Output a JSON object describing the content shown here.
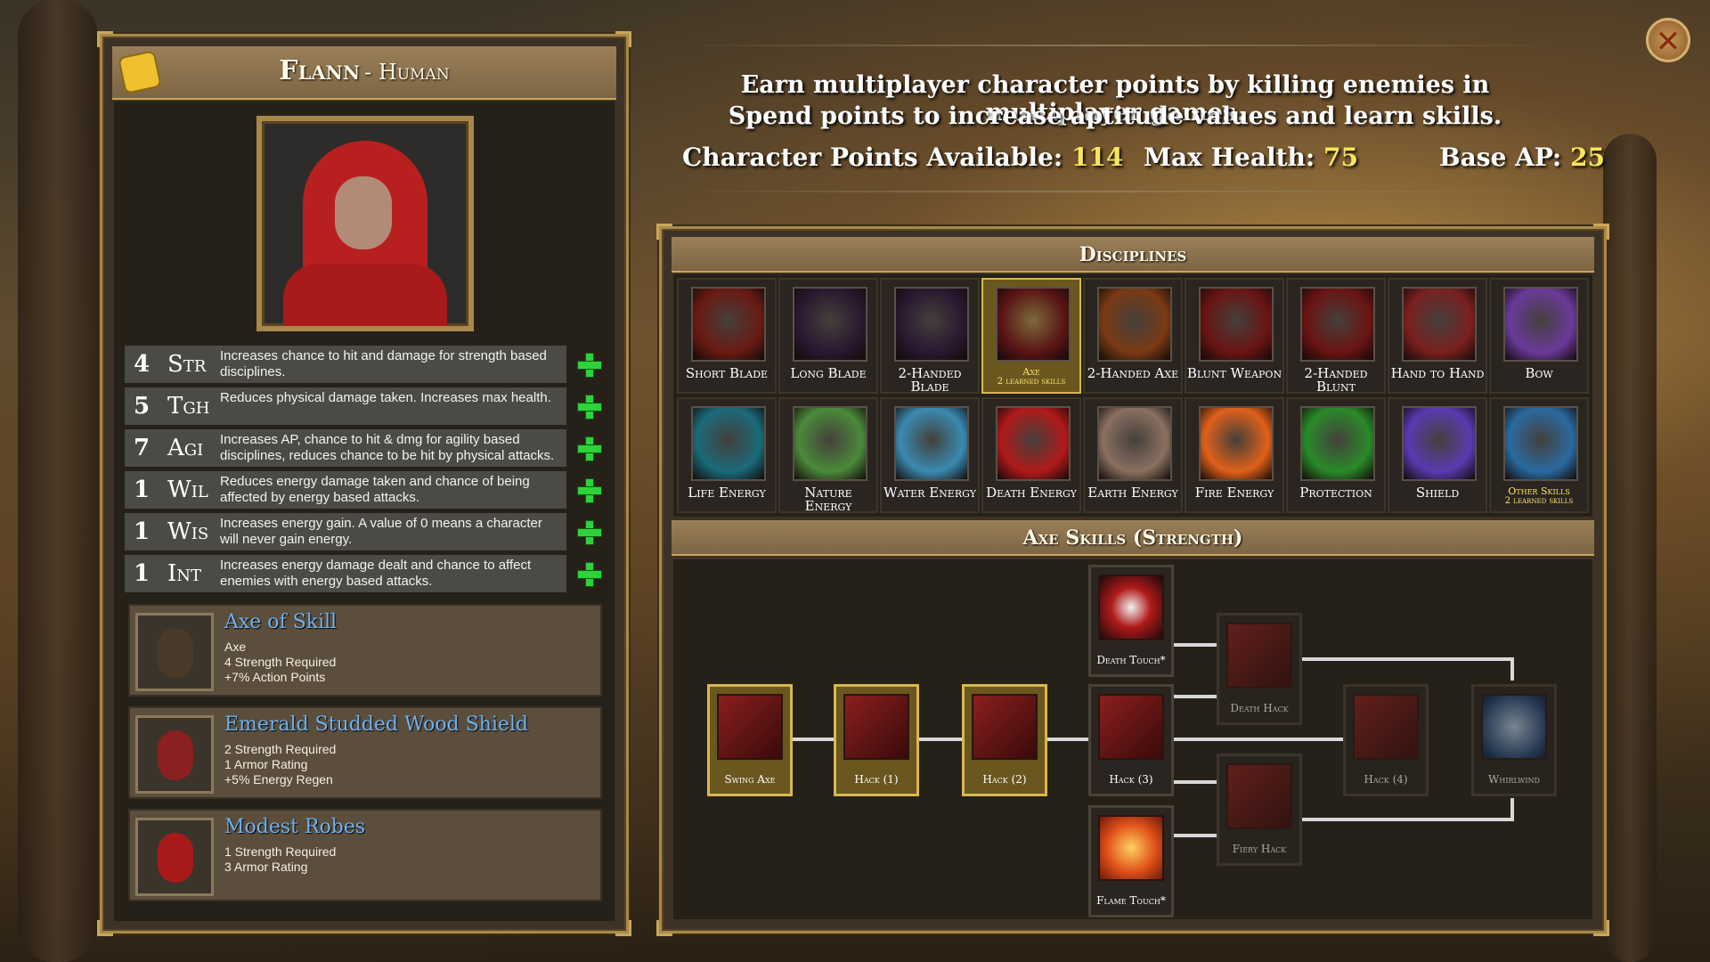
{
  "character": {
    "name": "Flann",
    "race": "Human"
  },
  "info": {
    "line1": "Earn multiplayer character points by killing enemies in multiplayer games.",
    "line2": "Spend points to increase aptitude values and learn skills.",
    "points_label": "Character Points Available:",
    "points_value": "114",
    "health_label": "Max Health:",
    "health_value": "75",
    "ap_label": "Base AP:",
    "ap_value": "25"
  },
  "stats": [
    {
      "value": "4",
      "name": "Str",
      "desc": "Increases chance to hit and damage for strength based disciplines."
    },
    {
      "value": "5",
      "name": "Tgh",
      "desc": "Reduces physical damage taken. Increases max health."
    },
    {
      "value": "7",
      "name": "Agi",
      "desc": "Increases AP, chance to hit & dmg for agility based disciplines, reduces chance to be hit by physical attacks."
    },
    {
      "value": "1",
      "name": "Wil",
      "desc": "Reduces energy damage taken and chance of being affected by energy based attacks."
    },
    {
      "value": "1",
      "name": "Wis",
      "desc": "Increases energy gain. A value of 0 means a character will never gain energy."
    },
    {
      "value": "1",
      "name": "Int",
      "desc": "Increases energy damage dealt and chance to affect enemies with energy based attacks."
    }
  ],
  "equipment": [
    {
      "name": "Axe of Skill",
      "lines": [
        "Axe",
        "4 Strength Required",
        "+7% Action Points"
      ]
    },
    {
      "name": "Emerald Studded Wood Shield",
      "lines": [
        "2 Strength Required",
        "1 Armor Rating",
        "+5% Energy Regen"
      ]
    },
    {
      "name": "Modest Robes",
      "lines": [
        "1 Strength Required",
        "3 Armor Rating"
      ]
    }
  ],
  "disciplines_title": "Disciplines",
  "disciplines": [
    {
      "label": "Short Blade",
      "sub": "",
      "color": "#6a1a14"
    },
    {
      "label": "Long Blade",
      "sub": "",
      "color": "#2a1830"
    },
    {
      "label": "2-Handed Blade",
      "sub": "",
      "color": "#2a1830"
    },
    {
      "label": "Axe",
      "sub": "2 learned skills",
      "color": "#5a1414"
    },
    {
      "label": "2-Handed Axe",
      "sub": "",
      "color": "#7a3a14"
    },
    {
      "label": "Blunt Weapon",
      "sub": "",
      "color": "#6a1414"
    },
    {
      "label": "2-Handed Blunt",
      "sub": "",
      "color": "#6a1414"
    },
    {
      "label": "Hand to Hand",
      "sub": "",
      "color": "#7a2020"
    },
    {
      "label": "Bow",
      "sub": "",
      "color": "#6a3a9a"
    },
    {
      "label": "Life Energy",
      "sub": "",
      "color": "#1a6a7a"
    },
    {
      "label": "Nature Energy",
      "sub": "",
      "color": "#4a8a3a"
    },
    {
      "label": "Water Energy",
      "sub": "",
      "color": "#3a8ab0"
    },
    {
      "label": "Death Energy",
      "sub": "",
      "color": "#b01a1a"
    },
    {
      "label": "Earth Energy",
      "sub": "",
      "color": "#8a7060"
    },
    {
      "label": "Fire Energy",
      "sub": "",
      "color": "#e0601a"
    },
    {
      "label": "Protection",
      "sub": "",
      "color": "#2a8a2a"
    },
    {
      "label": "Shield",
      "sub": "",
      "color": "#5a3ab0"
    },
    {
      "label": "Other Skills",
      "sub": "2 learned skills",
      "color": "#2a6aa0"
    }
  ],
  "skills_title": "Axe Skills (Strength)",
  "skills": [
    {
      "id": "swing-axe",
      "label": "Swing Axe",
      "state": "learned"
    },
    {
      "id": "hack-1",
      "label": "Hack (1)",
      "state": "learned"
    },
    {
      "id": "hack-2",
      "label": "Hack (2)",
      "state": "learned"
    },
    {
      "id": "death-touch",
      "label": "Death Touch*",
      "state": "normal"
    },
    {
      "id": "hack-3",
      "label": "Hack (3)",
      "state": "normal"
    },
    {
      "id": "flame-touch",
      "label": "Flame Touch*",
      "state": "normal"
    },
    {
      "id": "death-hack",
      "label": "Death Hack",
      "state": "dim"
    },
    {
      "id": "fiery-hack",
      "label": "Fiery Hack",
      "state": "dim"
    },
    {
      "id": "hack-4",
      "label": "Hack (4)",
      "state": "dim"
    },
    {
      "id": "whirlwind",
      "label": "Whirlwind",
      "state": "dim"
    }
  ]
}
